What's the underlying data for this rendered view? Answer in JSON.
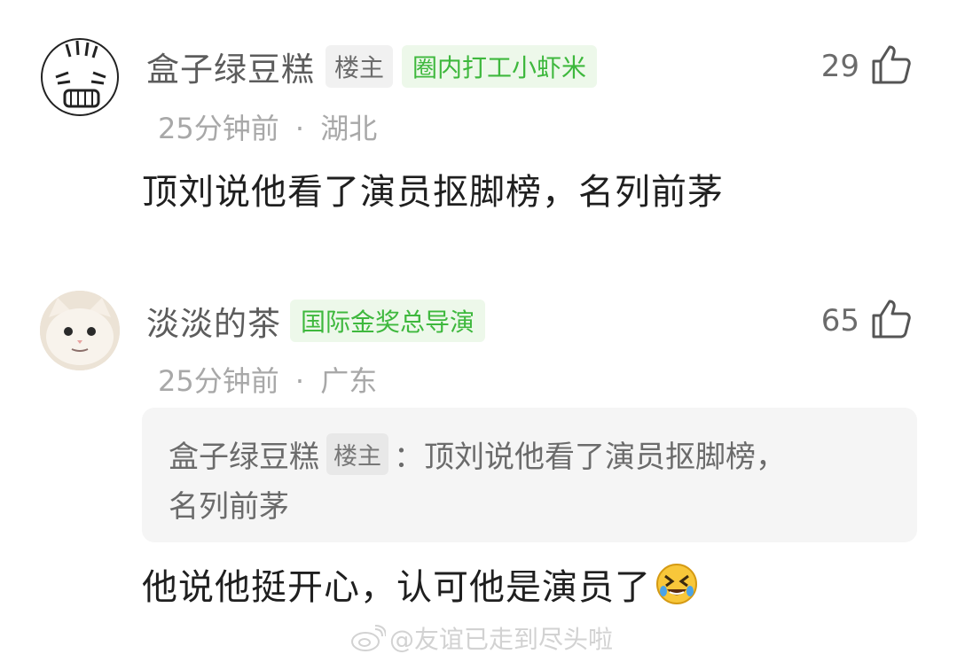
{
  "comments": [
    {
      "username": "盒子绿豆糕",
      "op_tag": "楼主",
      "title_tag": "圈内打工小虾米",
      "time": "25分钟前",
      "separator": "·",
      "location": "湖北",
      "likes": "29",
      "text": "顶刘说他看了演员抠脚榜，名列前茅",
      "avatar_icon": "cartoon-face-icon"
    },
    {
      "username": "淡淡的茶",
      "title_tag": "国际金奖总导演",
      "time": "25分钟前",
      "separator": "·",
      "location": "广东",
      "likes": "65",
      "quote": {
        "username": "盒子绿豆糕",
        "op_tag": "楼主",
        "colon": "：",
        "text_line1": "顶刘说他看了演员抠脚榜，",
        "text_line2": "名列前茅"
      },
      "text": "他说他挺开心，认可他是演员了",
      "emoji_icon": "rofl-emoji-icon",
      "avatar_icon": "cat-avatar-icon"
    }
  ],
  "watermark": {
    "text": "@友谊已走到尽头啦",
    "icon": "weibo-icon"
  },
  "colors": {
    "green_tag_text": "#3eb83d",
    "green_tag_bg": "#edf8ea",
    "meta_gray": "#a8a8a8"
  }
}
